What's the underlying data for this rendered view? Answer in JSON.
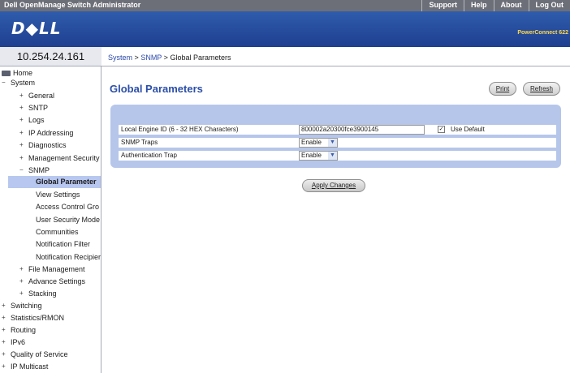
{
  "topbar": {
    "title": "Dell OpenManage Switch Administrator",
    "links": [
      "Support",
      "Help",
      "About",
      "Log Out"
    ]
  },
  "header": {
    "logo": "D◆LL",
    "model": "PowerConnect 622"
  },
  "ip_address": "10.254.24.161",
  "breadcrumb": {
    "system": "System",
    "snmp": "SNMP",
    "current": "Global Parameters",
    "sep": ">"
  },
  "nav": [
    {
      "label": "Home",
      "icon": "home-icon",
      "level": 0,
      "state": "home"
    },
    {
      "label": "System",
      "icon": "collapse-icon",
      "level": 0,
      "state": "open"
    },
    {
      "label": "General",
      "icon": "expand-icon",
      "level": 1,
      "state": "closed"
    },
    {
      "label": "SNTP",
      "icon": "expand-icon",
      "level": 1,
      "state": "closed"
    },
    {
      "label": "Logs",
      "icon": "expand-icon",
      "level": 1,
      "state": "closed"
    },
    {
      "label": "IP Addressing",
      "icon": "expand-icon",
      "level": 1,
      "state": "closed"
    },
    {
      "label": "Diagnostics",
      "icon": "expand-icon",
      "level": 1,
      "state": "closed"
    },
    {
      "label": "Management Security",
      "icon": "expand-icon",
      "level": 1,
      "state": "closed"
    },
    {
      "label": "SNMP",
      "icon": "collapse-icon",
      "level": 1,
      "state": "open"
    },
    {
      "label": "Global Parameter",
      "icon": "",
      "level": 2,
      "state": "active"
    },
    {
      "label": "View Settings",
      "icon": "",
      "level": 2,
      "state": "leaf"
    },
    {
      "label": "Access Control Gro",
      "icon": "",
      "level": 2,
      "state": "leaf"
    },
    {
      "label": "User Security Mode",
      "icon": "",
      "level": 2,
      "state": "leaf"
    },
    {
      "label": "Communities",
      "icon": "",
      "level": 2,
      "state": "leaf"
    },
    {
      "label": "Notification Filter",
      "icon": "",
      "level": 2,
      "state": "leaf"
    },
    {
      "label": "Notification Recipier",
      "icon": "",
      "level": 2,
      "state": "leaf"
    },
    {
      "label": "File Management",
      "icon": "expand-icon",
      "level": 1,
      "state": "closed"
    },
    {
      "label": "Advance Settings",
      "icon": "expand-icon",
      "level": 1,
      "state": "closed"
    },
    {
      "label": "Stacking",
      "icon": "expand-icon",
      "level": 1,
      "state": "closed"
    },
    {
      "label": "Switching",
      "icon": "expand-icon",
      "level": 0,
      "state": "closed"
    },
    {
      "label": "Statistics/RMON",
      "icon": "expand-icon",
      "level": 0,
      "state": "closed"
    },
    {
      "label": "Routing",
      "icon": "expand-icon",
      "level": 0,
      "state": "closed"
    },
    {
      "label": "IPv6",
      "icon": "expand-icon",
      "level": 0,
      "state": "closed"
    },
    {
      "label": "Quality of Service",
      "icon": "expand-icon",
      "level": 0,
      "state": "closed"
    },
    {
      "label": "IP Multicast",
      "icon": "expand-icon",
      "level": 0,
      "state": "closed"
    }
  ],
  "main": {
    "title": "Global Parameters",
    "print_label": "Print",
    "refresh_label": "Refresh",
    "form": {
      "engine_id_label": "Local Engine ID (6 - 32 HEX Characters)",
      "engine_id_value": "800002a20300fce3900145",
      "use_default_label": "Use Default",
      "use_default_checked": true,
      "snmp_traps_label": "SNMP Traps",
      "snmp_traps_value": "Enable",
      "auth_trap_label": "Authentication Trap",
      "auth_trap_value": "Enable"
    },
    "apply_label": "Apply Changes"
  },
  "colors": {
    "header_blue": "#2a4f9f",
    "panel_blue": "#b6c6ea",
    "title_blue": "#2b4ea8",
    "active_nav": "#b7c7ef"
  }
}
